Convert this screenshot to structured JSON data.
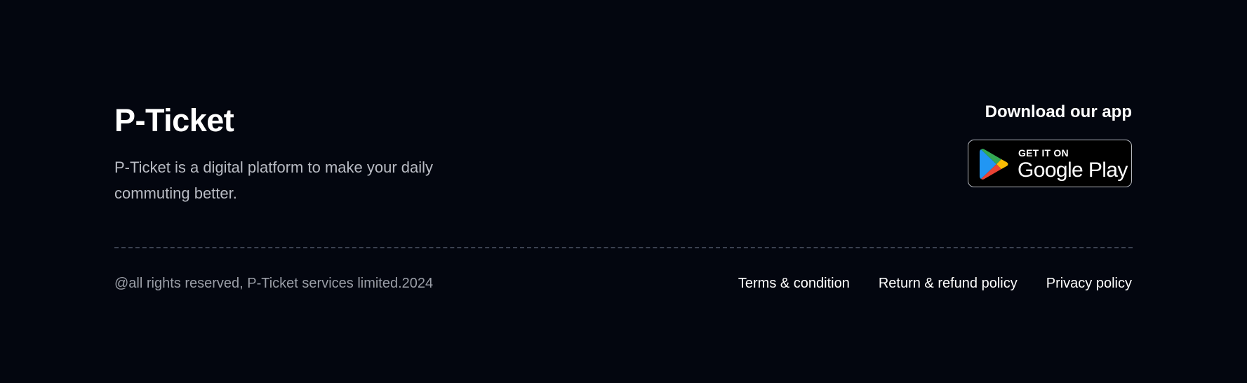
{
  "brand": {
    "title": "P-Ticket",
    "description": "P-Ticket is a digital platform to make your daily commuting better."
  },
  "download": {
    "heading": "Download our app",
    "badge_small": "GET IT ON",
    "badge_big": "Google Play",
    "icon": "google-play-icon"
  },
  "footer_bottom": {
    "copyright": "@all rights reserved, P-Ticket services limited.2024",
    "links": [
      "Terms & condition",
      "Return & refund policy",
      "Privacy policy"
    ]
  },
  "colors": {
    "background": "#03060f",
    "text_primary": "#ffffff",
    "text_secondary": "#b9bcc4",
    "text_muted": "#9a9ea7",
    "divider": "#3b4150"
  }
}
